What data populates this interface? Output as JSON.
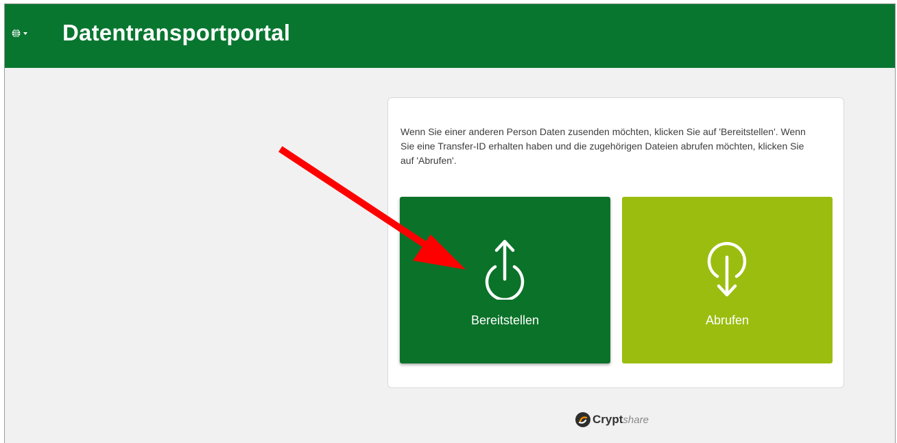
{
  "header": {
    "title": "Datentransportportal",
    "language_icon": "globe-icon",
    "background_color": "#08762f"
  },
  "main": {
    "intro_text": "Wenn Sie einer anderen Person Daten zusenden möchten, klicken Sie auf 'Bereitstellen'. Wenn Sie eine Transfer-ID erhalten haben und die zugehörigen Dateien abrufen möchten, klicken Sie auf 'Abrufen'.",
    "tiles": [
      {
        "label": "Bereitstellen",
        "icon": "upload-icon",
        "color": "#0b7229"
      },
      {
        "label": "Abrufen",
        "icon": "download-icon",
        "color": "#9bbd0f"
      }
    ]
  },
  "footer": {
    "logo_bold": "Crypt",
    "logo_light": "share"
  },
  "annotation": {
    "arrow_color": "#ff0000",
    "arrow_target": "Bereitstellen"
  }
}
